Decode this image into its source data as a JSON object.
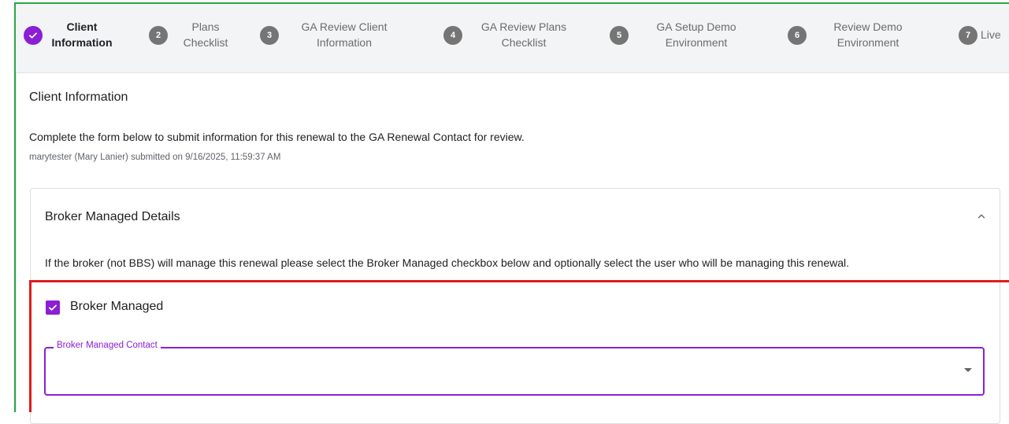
{
  "stepper": {
    "steps": [
      {
        "number": "",
        "label_line1": "Client",
        "label_line2": "Information",
        "state": "completed"
      },
      {
        "number": "2",
        "label_line1": "Plans",
        "label_line2": "Checklist",
        "state": "pending"
      },
      {
        "number": "3",
        "label_line1": "GA Review Client",
        "label_line2": "Information",
        "state": "pending"
      },
      {
        "number": "4",
        "label_line1": "GA Review Plans",
        "label_line2": "Checklist",
        "state": "pending"
      },
      {
        "number": "5",
        "label_line1": "GA Setup Demo",
        "label_line2": "Environment",
        "state": "pending"
      },
      {
        "number": "6",
        "label_line1": "Review Demo",
        "label_line2": "Environment",
        "state": "pending"
      },
      {
        "number": "7",
        "label_line1": "Live",
        "label_line2": "",
        "state": "pending"
      }
    ]
  },
  "main": {
    "section_title": "Client Information",
    "intro_text": "Complete the form below to submit information for this renewal to the GA Renewal Contact for review.",
    "submitted_text": "marytester (Mary Lanier) submitted on 9/16/2025, 11:59:37 AM"
  },
  "accordion": {
    "title": "Broker Managed Details",
    "expanded": true,
    "description": "If the broker (not BBS) will manage this renewal please select the Broker Managed checkbox below and optionally select the user who will be managing this renewal.",
    "checkbox": {
      "label": "Broker Managed",
      "checked": true
    },
    "contact_select": {
      "label": "Broker Managed Contact",
      "value": ""
    }
  },
  "colors": {
    "accent": "#8a1fd6",
    "pending_step": "#757575",
    "highlight_green": "#2aa64a",
    "highlight_red": "#e21b1b"
  },
  "icons": {
    "completed_step": "check-icon",
    "accordion_toggle": "chevron-up-icon",
    "select_toggle": "dropdown-arrow-icon"
  }
}
